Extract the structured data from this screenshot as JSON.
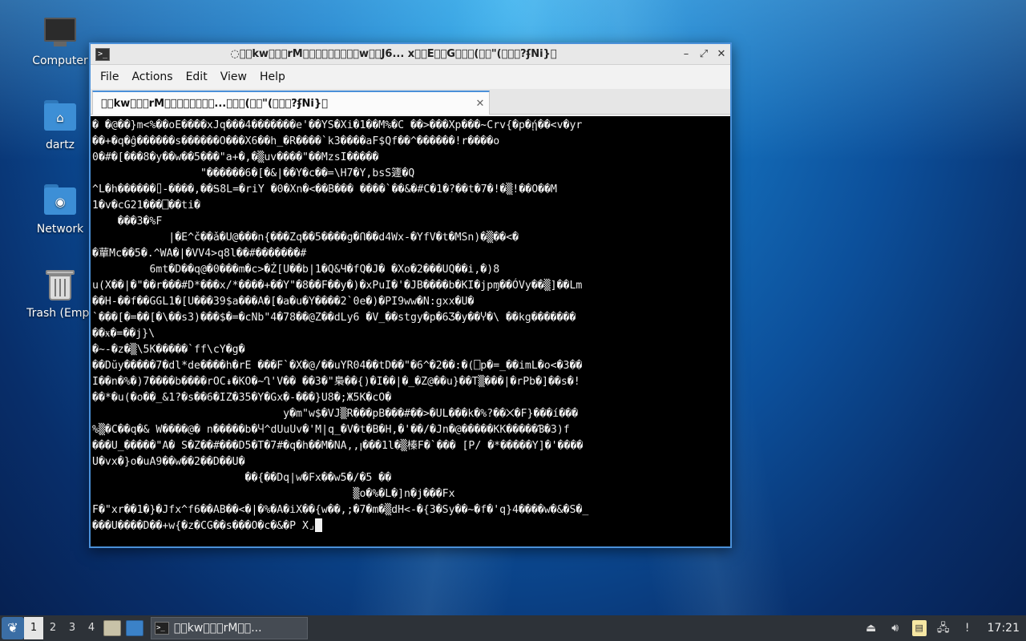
{
  "desktop": {
    "icons": [
      {
        "label": "Computer"
      },
      {
        "label": "dartz"
      },
      {
        "label": "Network"
      },
      {
        "label": "Trash (Empt"
      }
    ]
  },
  "window": {
    "title": "◌\u0000\u0000kw\u0000\u0000\u0000rM\u0000\u0000\u0000\u0000\u0000\u0000\u0000\u0000\u0000w\u0000\u0000J6...   x\u0000\u0000E\u0000\u0000G\u0000\u0000\u0000(\u0000\u0000\"(\u0000\u0000\u0000?ʄNi}\u0000",
    "controls": {
      "minimize": "–",
      "maximize": "⤢",
      "close": "✕"
    },
    "menu": [
      "File",
      "Actions",
      "Edit",
      "View",
      "Help"
    ],
    "tab": {
      "label": "\u0000\u0000kw\u0000\u0000\u0000rM\u0000\u0000\u0000\u0000\u0000\u0000\u0000\u0000...\u0000\u0000\u0000(\u0000\u0000\"(\u0000\u0000\u0000?ʄNi}\u0000",
      "close": "✕"
    },
    "terminal_lines": [
      "� �@��}m<%��oE����xJq���4�������e'��YS�Xi�1��M%�C ��>���Xp���~Crv{�p�ῄ��<v�yr",
      "��+�q�ĝ������s������O���X6��h_�R����`k3����aF$Qf��^������!r����o",
      "0�#�[���8�y��w��5���\"a+�,�▒uv����\"��MzsI�����",
      "                 \"������6�[�&|��Y�c��=\\H7�Y,bsS籧�Q",
      "^L�h������⌷-����,��Ꭶ8L=�riY �0�Xn�<��B��� ����`��&�#C�1�?��t�7�!�▒!��O��M",
      "1�v�cG21���⎕��ti�",
      "    ���3�%F",
      "            |�E^č��ǎ�U@���n{���Zq��5����g�Ո��d4Wx-�YfV�t�MSn)�▒��<�",
      "�蕇Mc��5�.^WA�|�VV4>q8l��#�������#",
      "         6mt�D��q@�0���m�c>�Ż[U��b|1�Q&Ч�fQ�J� �Xo�2���UQ��i,�)8",
      "u(X��|�\"��r���#D*���x/*����+��Y\"�8��F��y�)�xPuI�'�JB����b�KI�jpɱ��ÓVy��▒]��Lm",
      "��H-��f��GGL1�[U���39$a���A�[�a�u�Y����2`0e�)�PI9ww�N:gxx�U�",
      "`���[�=��[�\\��s3)���$�=�cNb\"4�78��@Z��dLy6 �V_��stgy�p�6Ʒ�y��Ⴤ�\\ ��kg�������",
      "��ӿ�=��j}\\",
      "�~-�z�▒\\5K�����`ff\\cY�g�",
      "��Dŭy�����7�dl*de����h�rE ���F`�X�@/��uYR04��tD��\"�6^�2��:�(⎕p�=_��imL�o<�3��",
      "I��n�%�)7����b����rOC↡�KO�~Ղ'V�� ��3�\"梟��{)�I��|�_�Z@��u}��T▒���|�rPb�]��s�!",
      "��*�u(�o��_&1?�s��6�IZ�35�Y�Gx�-���}U8�;Ж5K�cO�",
      "                              y�m\"w$�VJ▒R���pB���#��>�UL���k�%?��⨉�F}���í���",
      "%▒�C��q�& W����@� n�����b�Ⴗ^dUuUv�'M|q_�V�t�B�H,�'��/�Jn�@�����KK�����Ɓ�3)f",
      "���U_�����\"A� S�Z��#���D5�T�7#�q�h��M�NA,,ꞁ���1l�▒榛F�`��� [P/ �*�����Y]�'����",
      "U�vx�}o�uA9��w��2��D��U�",
      "                        ��{��Dq|w�Fx��w5�/�5 ��",
      "                                         ▒o�%�L�]n�j���Fx",
      "F�\"xr��1�}�Jfx^f6��AB��<�|�%�A�iX��{w��,;�7�m�▒dH<-�{3�Sy��~�f�'q}4����w�&�S�_",
      "���U����D��+w{�z�CG��s���O�c�&�P X⌟"
    ]
  },
  "taskbar": {
    "workspaces": [
      "1",
      "2",
      "3",
      "4"
    ],
    "active_workspace": "1",
    "task_label": "\u0000\u0000kw\u0000\u0000\u0000rM\u0000\u0000...",
    "clock": "17:21"
  },
  "colors": {
    "window_accent": "#4a90d9",
    "terminal_bg": "#000000",
    "terminal_fg": "#f0f0f0",
    "taskbar_bg": "#2d3238"
  }
}
